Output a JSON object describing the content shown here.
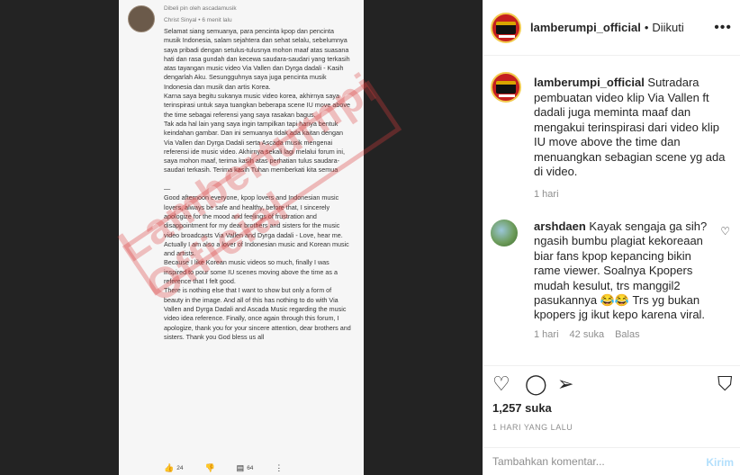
{
  "post_image": {
    "pinned_note": "Dibeli pin oleh ascadamusik",
    "comment_user": "Christ Sinyal • 6 menit lalu",
    "comment_body": "Selamat siang semuanya, para pencinta kpop dan pencinta musik Indonesia, salam sejahtera dan sehat selalu, sebelumnya saya pribadi dengan setulus-tulusnya mohon maaf atas suasana hati dan rasa gundah dan kecewa saudara-saudari yang terkasih atas tayangan music video Via Vallen dan Dyrga dadali - Kasih dengarlah Aku. Sesungguhnya saya juga pencinta musik Indonesia dan musik dan artis Korea.\nKarna saya begitu sukanya music video korea, akhirnya saya terinspirasi untuk saya tuangkan beberapa scene IU move above the time sebagai referensi yang saya rasakan bagus.\nTak ada hal lain yang saya ingin tampilkan tapi hanya bentuk keindahan gambar. Dan ini semuanya tidak ada kaitan dengan Via Vallen dan Dyrga Dadali serta Ascada musik mengenai referensi ide music video. Akhirnya sekali lagi melalui forum ini, saya mohon maaf, terima kasih atas perhatian tulus saudara-saudari terkasih. Terima kasih Tuhan memberkati kita semua\n\n—\nGood afternoon everyone, kpop lovers and Indonesian music lovers, always be safe and healthy, before that, I sincerely apologize for the mood and feelings of frustration and disappointment for my dear brothers and sisters for the music video broadcasts Via Vallen and Dyrga dadali - Love, hear me. Actually I am also a lover of Indonesian music and Korean music and artists.\nBecause I like Korean music videos so much, finally I was inspired to pour some IU scenes moving above the time as a reference that I felt good.\nThere is nothing else that I want to show but only a form of beauty in the image. And all of this has nothing to do with Via Vallen and Dyrga Dadali and Ascada Music regarding the music video idea reference. Finally, once again through this forum, I apologize, thank you for your sincere attention, dear brothers and sisters. Thank you God bless us all",
    "like_count": "24",
    "reply_count": "64",
    "watermark": "Lamberturnpi Official"
  },
  "header": {
    "username": "lamberumpi_official",
    "separator": "•",
    "follow_status": "Diikuti",
    "more_icon": "more-horizontal-icon"
  },
  "caption": {
    "username": "lamberumpi_official",
    "text": " Sutradara pembuatan video klip Via Vallen ft dadali juga meminta maaf dan mengakui terinspirasi dari video klip IU move above the time dan menuangkan sebagian scene yg ada di video.",
    "time": "1 hari"
  },
  "comment": {
    "username": "arshdaen",
    "text": " Kayak sengaja ga sih? ngasih bumbu plagiat kekoreaan biar fans kpop kepancing bikin rame viewer. Soalnya Kpopers mudah kesulut, trs manggil2 pasukannya 😂😂 Trs yg bukan kpopers jg ikut kepo karena viral.",
    "time": "1 hari",
    "likes": "42 suka",
    "reply": "Balas"
  },
  "actions": {
    "like_icon": "heart-icon",
    "comment_icon": "comment-icon",
    "share_icon": "share-icon",
    "save_icon": "bookmark-icon"
  },
  "likes_count": "1,257 suka",
  "post_date": "1 HARI YANG LALU",
  "comment_box": {
    "placeholder": "Tambahkan komentar...",
    "post_label": "Kirim"
  }
}
